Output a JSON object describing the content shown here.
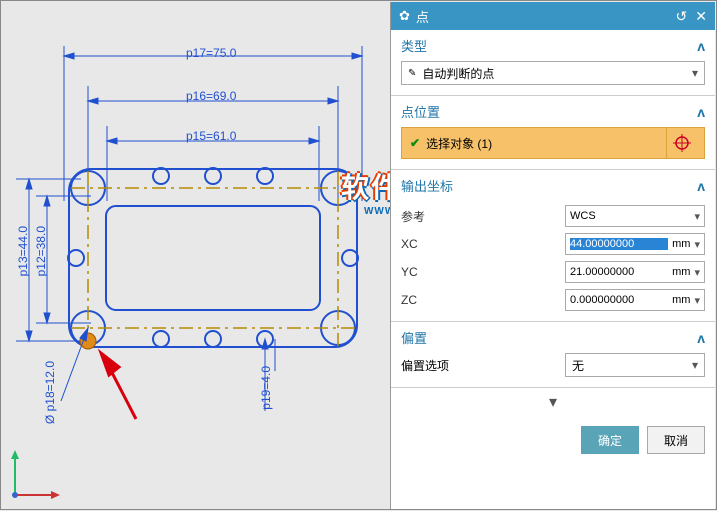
{
  "panel": {
    "title": "点",
    "sections": {
      "type": {
        "header": "类型",
        "combo_value": "自动判断的点"
      },
      "location": {
        "header": "点位置",
        "select_label": "选择对象 (1)"
      },
      "output": {
        "header": "输出坐标",
        "ref_label": "参考",
        "ref_value": "WCS",
        "xc_label": "XC",
        "xc_value": "44.00000000",
        "yc_label": "YC",
        "yc_value": "21.00000000",
        "zc_label": "ZC",
        "zc_value": "0.000000000",
        "unit": "mm"
      },
      "offset": {
        "header": "偏置",
        "opt_label": "偏置选项",
        "opt_value": "无"
      }
    },
    "buttons": {
      "ok": "确定",
      "cancel": "取消"
    }
  },
  "drawing": {
    "dims": {
      "p17": "p17=75.0",
      "p16": "p16=69.0",
      "p15": "p15=61.0",
      "p13": "p13=44.0",
      "p12": "p12=38.0",
      "p18": "Ø p18=12.0",
      "p19": "p19=4.0"
    }
  },
  "watermark": {
    "main": "软件自学网",
    "sub": "WWW.RJZXW.COM"
  }
}
